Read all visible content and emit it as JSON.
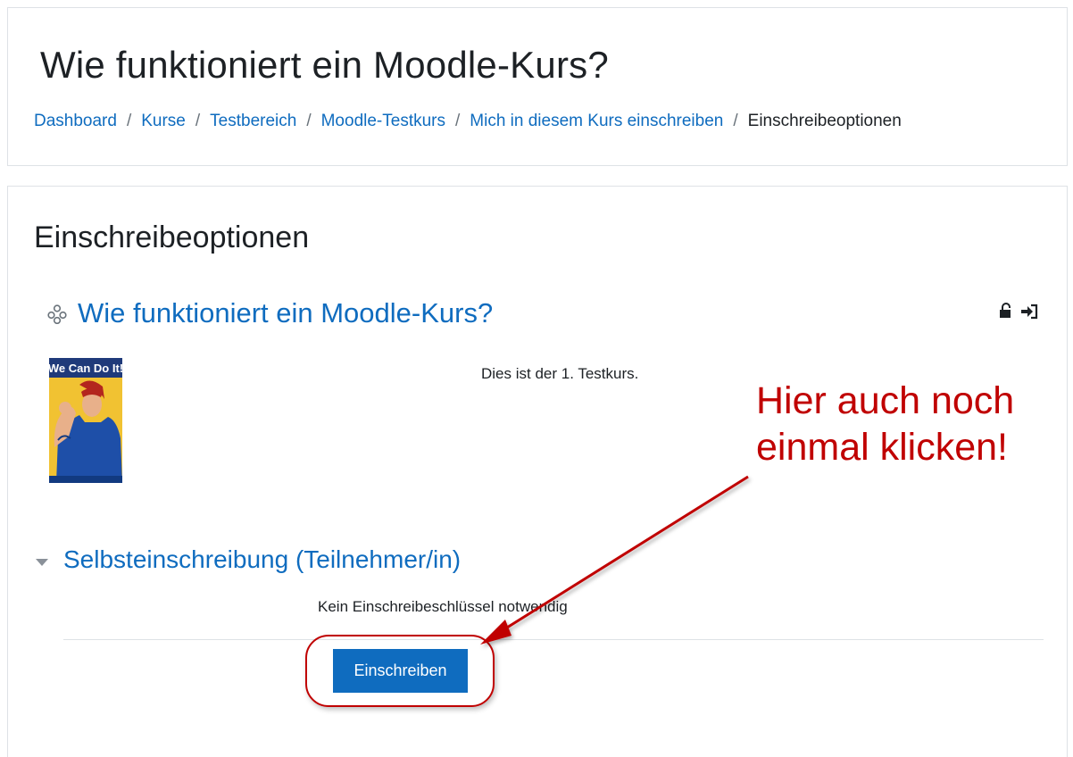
{
  "header": {
    "title": "Wie funktioniert ein Moodle-Kurs?",
    "breadcrumb": {
      "items": [
        {
          "label": "Dashboard"
        },
        {
          "label": "Kurse"
        },
        {
          "label": "Testbereich"
        },
        {
          "label": "Moodle-Testkurs"
        },
        {
          "label": "Mich in diesem Kurs einschreiben"
        }
      ],
      "separator": "/",
      "current": "Einschreibeoptionen"
    }
  },
  "main": {
    "heading": "Einschreibeoptionen",
    "course": {
      "icon": "course-category-icon",
      "name": "Wie funktioniert ein Moodle-Kurs?",
      "summary": "Dies ist der 1. Testkurs.",
      "image_text": "We Can Do It!",
      "enrol_icons": [
        "lock-open-icon",
        "sign-in-icon"
      ]
    },
    "self_enrolment": {
      "title": "Selbsteinschreibung (Teilnehmer/in)",
      "note": "Kein Einschreibeschlüssel notwendig",
      "button_label": "Einschreiben"
    }
  },
  "annotation": {
    "lines": [
      "Hier auch noch",
      "einmal klicken!"
    ],
    "color": "#c00000"
  },
  "colors": {
    "link": "#0f6cbf",
    "primary_button": "#0f6cbf",
    "annotation": "#c00000"
  }
}
